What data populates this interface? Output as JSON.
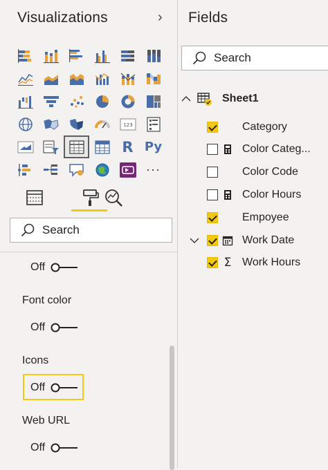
{
  "visualizations": {
    "title": "Visualizations",
    "collapse_icon": "chevron-right-icon",
    "icons": [
      "stacked-bar-icon",
      "stacked-column-icon",
      "clustered-bar-icon",
      "clustered-column-icon",
      "100-stacked-bar-icon",
      "100-stacked-column-icon",
      "line-chart-icon",
      "area-chart-icon",
      "stacked-area-icon",
      "line-clustered-column-icon",
      "line-stacked-column-icon",
      "ribbon-chart-icon",
      "waterfall-icon",
      "funnel-icon",
      "scatter-icon",
      "pie-chart-icon",
      "donut-chart-icon",
      "treemap-icon",
      "map-icon",
      "filled-map-icon",
      "shape-map-icon",
      "gauge-icon",
      "card-icon",
      "multi-row-card-icon",
      "kpi-icon",
      "slicer-icon",
      "table-icon",
      "matrix-icon",
      "r-visual-icon",
      "python-visual-icon",
      "key-influencers-icon",
      "decomposition-tree-icon",
      "qa-icon",
      "arcgis-map-icon",
      "powerapps-icon",
      "more-icon"
    ],
    "r_label": "R",
    "py_label": "Py",
    "more_label": "···",
    "tabs": [
      "fields-tab-icon",
      "format-paint-roller-icon",
      "analytics-magnifier-icon"
    ],
    "active_tab": "format",
    "search_placeholder": "Search",
    "format_items": [
      {
        "label": "",
        "toggle": "Off"
      },
      {
        "label": "Font color",
        "toggle": "Off"
      },
      {
        "label": "Icons",
        "toggle": "Off"
      },
      {
        "label": "Web URL",
        "toggle": "Off"
      }
    ],
    "accent_color": "#f2c811"
  },
  "fields": {
    "title": "Fields",
    "search_placeholder": "Search",
    "table": {
      "name": "Sheet1",
      "expanded": true
    },
    "items": [
      {
        "label": "Category",
        "checked": true,
        "icon": ""
      },
      {
        "label": "Color Categ...",
        "checked": false,
        "icon": "calculator-icon"
      },
      {
        "label": "Color Code",
        "checked": false,
        "icon": ""
      },
      {
        "label": "Color Hours",
        "checked": false,
        "icon": "calculator-icon"
      },
      {
        "label": "Empoyee",
        "checked": true,
        "icon": ""
      },
      {
        "label": "Work Date",
        "checked": true,
        "icon": "calendar-icon",
        "expandable": true
      },
      {
        "label": "Work Hours",
        "checked": true,
        "icon": "sigma-icon"
      }
    ]
  }
}
